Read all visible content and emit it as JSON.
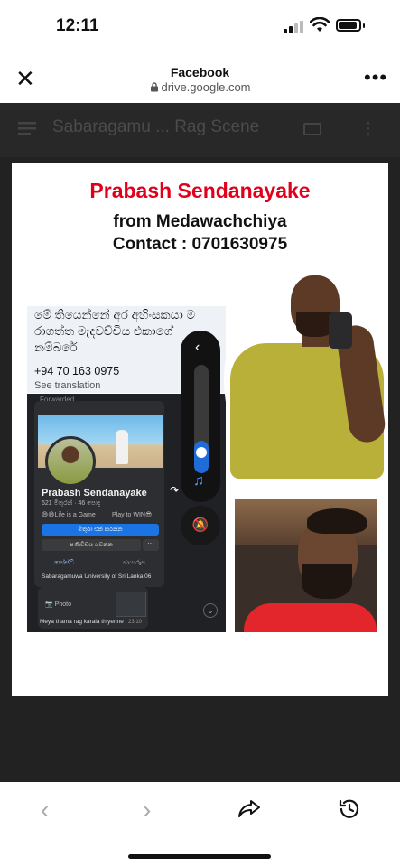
{
  "status": {
    "time": "12:11"
  },
  "titlebar": {
    "title": "Facebook",
    "url": "drive.google.com"
  },
  "viewer": {
    "title": "Sabaragamu ... Rag Scene"
  },
  "poster": {
    "name": "Prabash Sendanayake",
    "from": "from Medawachchiya",
    "contact": "Contact : 0701630975",
    "colors": {
      "name": "#e0001b"
    }
  },
  "screenshot": {
    "sinhala_text": "මේ තියෙන්නේ අර අහිංසකයා ම රාගත්ත මැදවච්චිය එකාගේ නම්බරේ",
    "phone": "+94 70 163 0975",
    "see_translation": "See translation",
    "forwarded": "Forwarded",
    "profile_name": "Prabash Sendanayake",
    "stats": "621 මිතුරන් · 46 පොදු",
    "life": "😄😄Life is a Game",
    "play": "Play to WIN😎",
    "friend_button": "මිතුරා එක් කරන්න",
    "message_button": "පණිවිඩය යවන්න",
    "more": "···",
    "tab_posts": "පෝස්ට්",
    "tab_photos": "ඡායාරූප",
    "university": "Sabaragamuwa University of Sri Lanka 06",
    "photo_label": "Photo",
    "message_text": "Meya thama rag karala thiyenne",
    "message_time": "23:10"
  },
  "icons": [
    "close-icon",
    "more-icon",
    "lock-icon",
    "signal-icon",
    "wifi-icon",
    "battery-icon",
    "menu-icon",
    "chevron-left-icon",
    "music-note-icon",
    "bell-off-icon",
    "back-icon",
    "forward-icon",
    "share-icon",
    "history-icon"
  ]
}
